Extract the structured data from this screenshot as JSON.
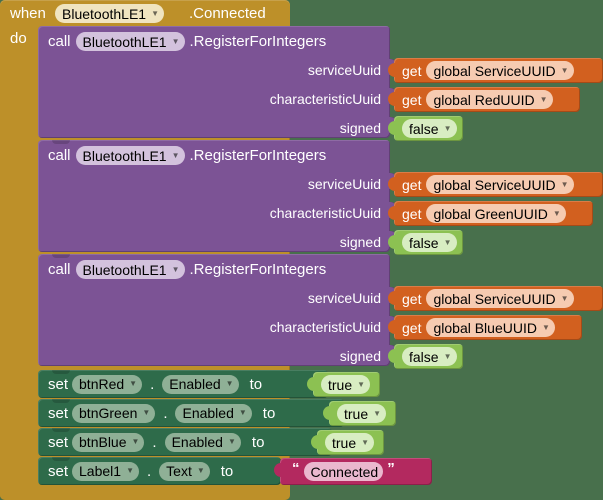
{
  "app": {
    "editor": "MIT App Inventor Blocks Editor",
    "background_color": "#48704c"
  },
  "colors": {
    "event_block": "#bd9029",
    "call_block": "#7c5395",
    "set_block": "#2e6b4a",
    "get_block": "#d2601f",
    "logic_block": "#8cc152",
    "text_block": "#b3295f"
  },
  "event": {
    "keyword": "when",
    "component": "BluetoothLE1",
    "event_name": ".Connected",
    "body_keyword": "do"
  },
  "calls": [
    {
      "keyword": "call",
      "component": "BluetoothLE1",
      "method": ".RegisterForIntegers",
      "params": [
        {
          "label": "serviceUuid",
          "value_kind": "get",
          "get_keyword": "get",
          "value": "global ServiceUUID"
        },
        {
          "label": "characteristicUuid",
          "value_kind": "get",
          "get_keyword": "get",
          "value": "global RedUUID"
        },
        {
          "label": "signed",
          "value_kind": "logic",
          "value": "false"
        }
      ]
    },
    {
      "keyword": "call",
      "component": "BluetoothLE1",
      "method": ".RegisterForIntegers",
      "params": [
        {
          "label": "serviceUuid",
          "value_kind": "get",
          "get_keyword": "get",
          "value": "global ServiceUUID"
        },
        {
          "label": "characteristicUuid",
          "value_kind": "get",
          "get_keyword": "get",
          "value": "global GreenUUID"
        },
        {
          "label": "signed",
          "value_kind": "logic",
          "value": "false"
        }
      ]
    },
    {
      "keyword": "call",
      "component": "BluetoothLE1",
      "method": ".RegisterForIntegers",
      "params": [
        {
          "label": "serviceUuid",
          "value_kind": "get",
          "get_keyword": "get",
          "value": "global ServiceUUID"
        },
        {
          "label": "characteristicUuid",
          "value_kind": "get",
          "get_keyword": "get",
          "value": "global BlueUUID"
        },
        {
          "label": "signed",
          "value_kind": "logic",
          "value": "false"
        }
      ]
    }
  ],
  "setters": [
    {
      "keyword": "set",
      "component": "btnRed",
      "property": "Enabled",
      "to": "to",
      "value_kind": "logic",
      "value": "true"
    },
    {
      "keyword": "set",
      "component": "btnGreen",
      "property": "Enabled",
      "to": "to",
      "value_kind": "logic",
      "value": "true"
    },
    {
      "keyword": "set",
      "component": "btnBlue",
      "property": "Enabled",
      "to": "to",
      "value_kind": "logic",
      "value": "true"
    },
    {
      "keyword": "set",
      "component": "Label1",
      "property": "Text",
      "to": "to",
      "value_kind": "text",
      "value": "Connected",
      "open_quote": "“",
      "close_quote": "”"
    }
  ],
  "icons": {
    "dropdown_caret": "▼"
  }
}
